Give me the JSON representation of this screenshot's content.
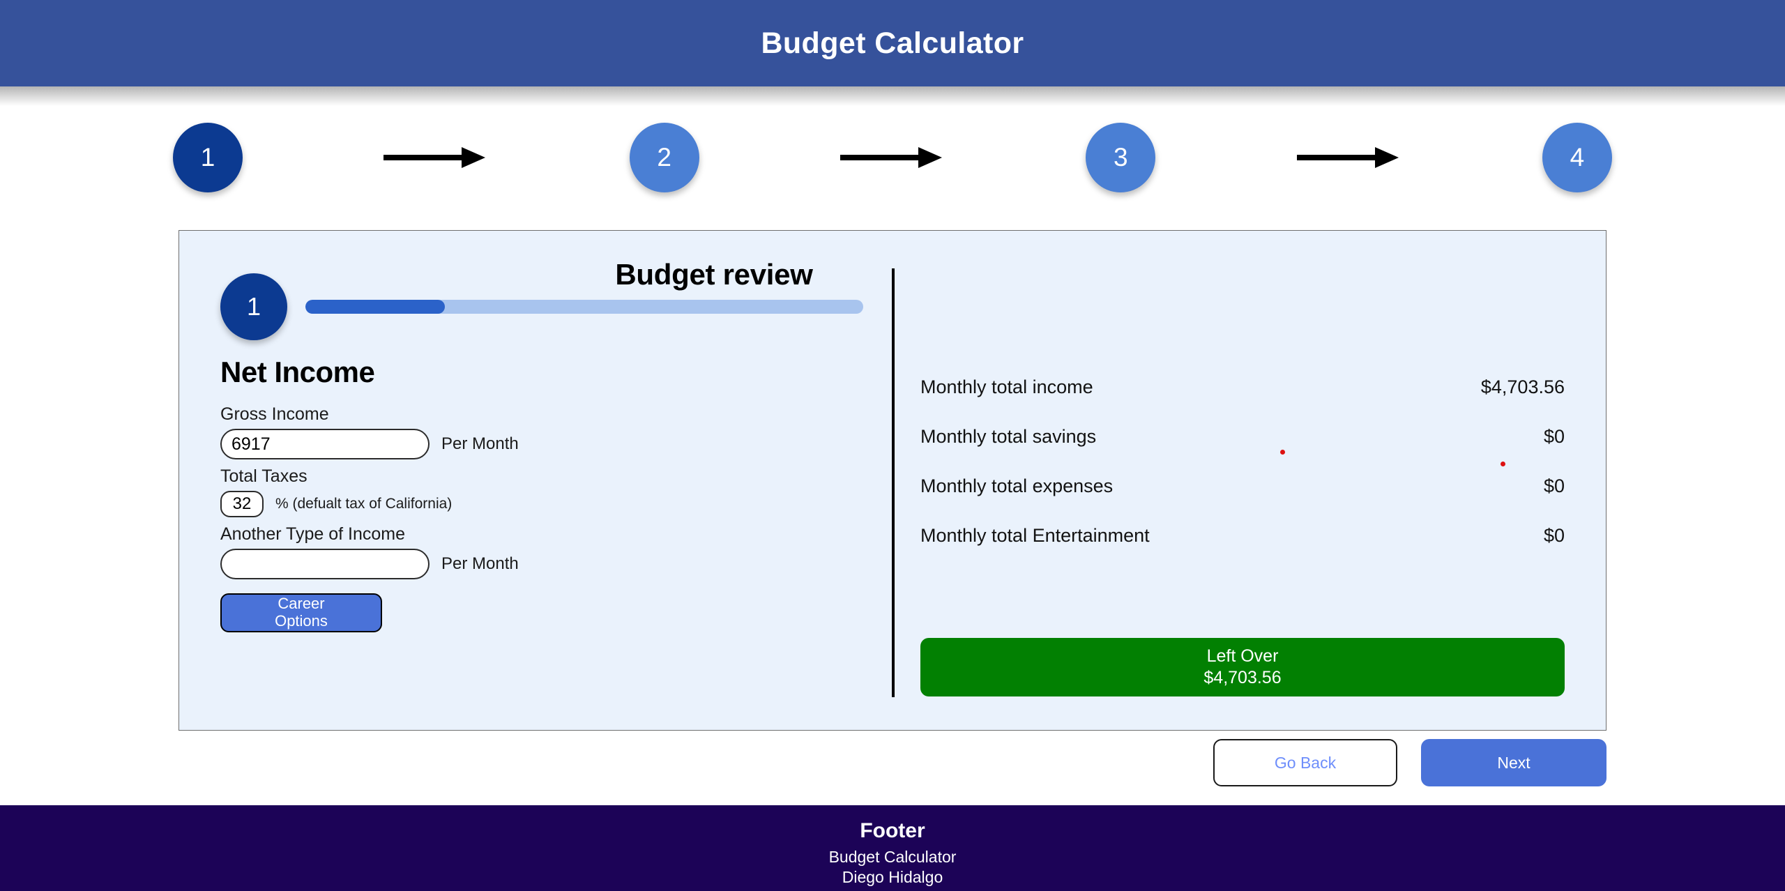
{
  "header": {
    "title": "Budget Calculator",
    "background": "#36529b",
    "text_color": "#ffffff"
  },
  "stepper": {
    "steps": [
      {
        "number": "1",
        "state": "active",
        "color": "#0c3a91"
      },
      {
        "number": "2",
        "state": "idle",
        "color": "#4a7fd4"
      },
      {
        "number": "3",
        "state": "idle",
        "color": "#4a7fd4"
      },
      {
        "number": "4",
        "state": "idle",
        "color": "#4a7fd4"
      }
    ],
    "arrow_icon": "arrow-right-icon"
  },
  "form_panel": {
    "progress": {
      "step_number": "1",
      "percent": 25,
      "fill_color": "#2b62c9",
      "track_color": "#a8c4ee"
    },
    "title": "Net Income",
    "fields": [
      {
        "label": "Gross Income",
        "value": "6917",
        "placeholder": "",
        "suffix": "Per Month"
      },
      {
        "label": "Total Taxes",
        "value": "32",
        "placeholder": "",
        "suffix": "% (defualt tax of California)"
      },
      {
        "label": "Another Type of Income",
        "value": "",
        "placeholder": "",
        "suffix": "Per Month"
      }
    ],
    "career_button": "Career\nOptions",
    "career_button_line1": "Career",
    "career_button_line2": "Options"
  },
  "review_panel": {
    "title": "Budget review",
    "rows": [
      {
        "label": "Monthly total income",
        "value": "$4,703.56"
      },
      {
        "label": "Monthly total savings",
        "value": "$0"
      },
      {
        "label": "Monthly total expenses",
        "value": "$0"
      },
      {
        "label": "Monthly total Entertainment",
        "value": "$0"
      }
    ],
    "leftover": {
      "label": "Left Over",
      "value": "$4,703.56",
      "color": "#028002"
    },
    "marker_color": "#dd1111"
  },
  "nav": {
    "back_label": "Go Back",
    "next_label": "Next",
    "next_color": "#4a72d8"
  },
  "footer": {
    "title": "Footer",
    "line1": "Budget Calculator",
    "line2": "Diego Hidalgo",
    "background": "#1c0357"
  }
}
